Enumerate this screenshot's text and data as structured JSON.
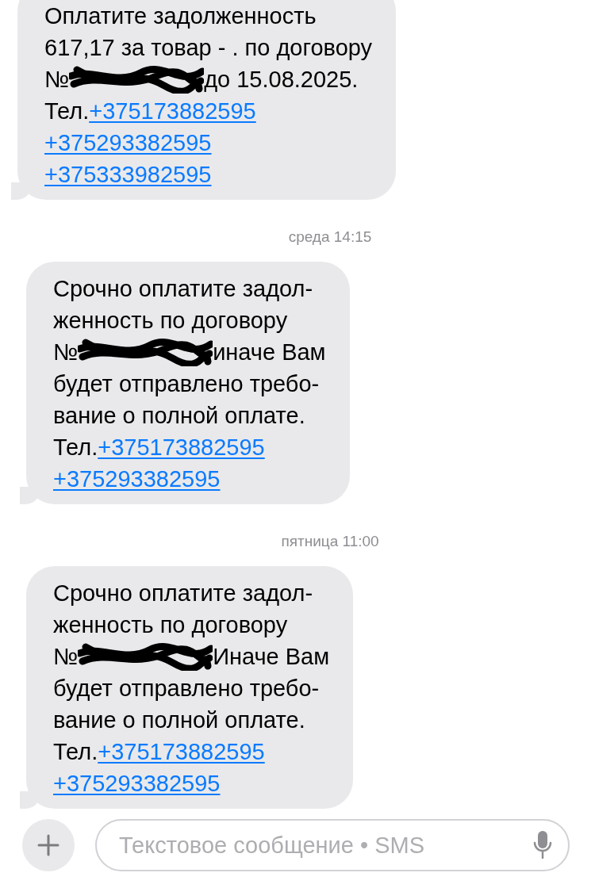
{
  "messages": [
    {
      "lines": [
        [
          {
            "kind": "text",
            "text": "Оплатите задолженность"
          }
        ],
        [
          {
            "kind": "text",
            "text": "617,17 за товар - . по договору"
          }
        ],
        [
          {
            "kind": "text",
            "text": "№"
          },
          {
            "kind": "redaction"
          },
          {
            "kind": "text",
            "text": "до 15.08.2025."
          }
        ],
        [
          {
            "kind": "text",
            "text": "Тел."
          },
          {
            "kind": "link",
            "text": "+375173882595"
          }
        ],
        [
          {
            "kind": "link",
            "text": "+375293382595"
          }
        ],
        [
          {
            "kind": "link",
            "text": "+375333982595"
          }
        ]
      ]
    },
    {
      "timestamp": "среда 14:15",
      "lines": [
        [
          {
            "kind": "text",
            "text": "Срочно оплатите задол-"
          }
        ],
        [
          {
            "kind": "text",
            "text": "женность по договору"
          }
        ],
        [
          {
            "kind": "text",
            "text": "№"
          },
          {
            "kind": "redaction"
          },
          {
            "kind": "text",
            "text": "иначе Вам"
          }
        ],
        [
          {
            "kind": "text",
            "text": "будет отправлено требо-"
          }
        ],
        [
          {
            "kind": "text",
            "text": "вание о полной оплате."
          }
        ],
        [
          {
            "kind": "text",
            "text": "Тел. "
          },
          {
            "kind": "link",
            "text": "+375173882595"
          }
        ],
        [
          {
            "kind": "link",
            "text": "+375293382595"
          }
        ]
      ]
    },
    {
      "timestamp": "пятница 11:00",
      "lines": [
        [
          {
            "kind": "text",
            "text": "Срочно оплатите задол-"
          }
        ],
        [
          {
            "kind": "text",
            "text": "женность по договору"
          }
        ],
        [
          {
            "kind": "text",
            "text": "№"
          },
          {
            "kind": "redaction"
          },
          {
            "kind": "text",
            "text": "Иначе Вам"
          }
        ],
        [
          {
            "kind": "text",
            "text": "будет отправлено требо-"
          }
        ],
        [
          {
            "kind": "text",
            "text": "вание о полной оплате."
          }
        ],
        [
          {
            "kind": "text",
            "text": "Тел. "
          },
          {
            "kind": "link",
            "text": "+375173882595"
          }
        ],
        [
          {
            "kind": "link",
            "text": "+375293382595"
          }
        ]
      ]
    }
  ],
  "composer": {
    "placeholder": "Текстовое сообщение • SMS"
  }
}
